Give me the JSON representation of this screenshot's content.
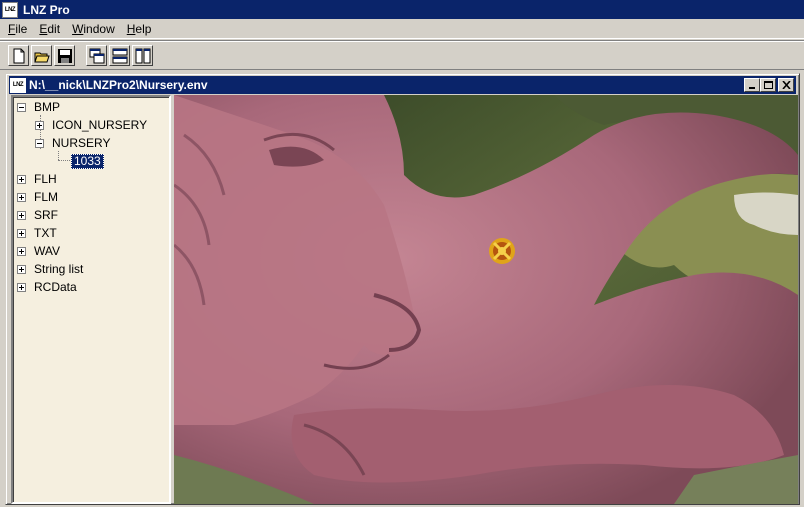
{
  "app": {
    "title": "LNZ Pro",
    "logo_text": "LNZ"
  },
  "menu": {
    "items": [
      {
        "key": "F",
        "rest": "ile"
      },
      {
        "key": "E",
        "rest": "dit"
      },
      {
        "key": "W",
        "rest": "indow"
      },
      {
        "key": "H",
        "rest": "elp"
      }
    ]
  },
  "toolbar": {
    "buttons": [
      "new-file-icon",
      "open-folder-icon",
      "save-icon",
      "cascade-windows-icon",
      "tile-horizontal-icon",
      "tile-vertical-icon"
    ]
  },
  "child_window": {
    "title": "N:\\__nick\\LNZPro2\\Nursery.env",
    "logo_text": "LNZ"
  },
  "tree": {
    "bmp": "BMP",
    "icon_nursery": "ICON_NURSERY",
    "nursery": "NURSERY",
    "item_1033": "1033",
    "flh": "FLH",
    "flm": "FLM",
    "srf": "SRF",
    "txt": "TXT",
    "wav": "WAV",
    "string_list": "String list",
    "rcdata": "RCData"
  },
  "colors": {
    "titlebar": "#0a246a",
    "tree_background": "#f5efdf",
    "stone": "#b46e7e"
  }
}
